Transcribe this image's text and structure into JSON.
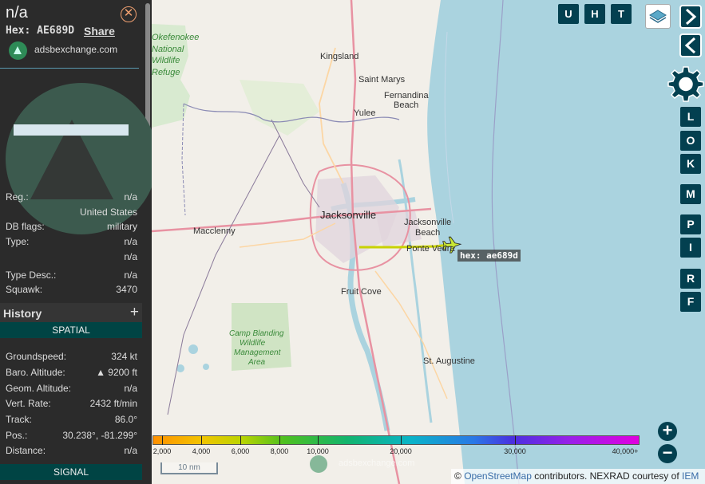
{
  "sidebar": {
    "callsign": "n/a",
    "hex_label": "Hex:",
    "hex_value": "AE689D",
    "share_label": "Share",
    "site_link": "adsbexchange.com",
    "close_icon": "close-icon",
    "details": [
      {
        "label": "Reg.:",
        "value": "n/a"
      },
      {
        "label": "",
        "value": "United States"
      },
      {
        "label": "DB flags:",
        "value": "military"
      },
      {
        "label": "Type:",
        "value": "n/a"
      },
      {
        "label": "",
        "value": "n/a"
      },
      {
        "label": "Type Desc.:",
        "value": "n/a"
      },
      {
        "label": "Squawk:",
        "value": "3470"
      }
    ],
    "history_label": "History",
    "history_toggle": "+",
    "spatial_label": "SPATIAL",
    "spatial": [
      {
        "label": "Groundspeed:",
        "value": "324 kt"
      },
      {
        "label": "Baro. Altitude:",
        "value": "▲ 9200 ft"
      },
      {
        "label": "Geom. Altitude:",
        "value": "n/a"
      },
      {
        "label": "Vert. Rate:",
        "value": "2432 ft/min"
      },
      {
        "label": "Track:",
        "value": "86.0°"
      },
      {
        "label": "Pos.:",
        "value": "30.238°, -81.299°"
      },
      {
        "label": "Distance:",
        "value": "n/a"
      }
    ],
    "signal_label": "SIGNAL"
  },
  "map": {
    "places": [
      "Okefenokee",
      "National",
      "Wildlife",
      "Refuge",
      "Kingsland",
      "Saint Marys",
      "Fernandina",
      "Beach",
      "Yulee",
      "Jacksonville",
      "Jacksonville",
      "Beach",
      "Macclenny",
      "Ponte Vedra",
      "Fruit Cove",
      "Camp Blanding",
      "Wildlife",
      "Management",
      "Area",
      "St. Augustine"
    ],
    "aircraft_label": "hex: ae689d",
    "toolbar": [
      "U",
      "H",
      "T"
    ],
    "side_buttons": [
      "L",
      "O",
      "K",
      "M",
      "P",
      "I",
      "R",
      "F"
    ],
    "nav_next_icon": "chevron-right-icon",
    "nav_prev_icon": "chevron-left-icon",
    "layers_icon": "layers-icon",
    "settings_icon": "gear-icon",
    "zoom_in": "+",
    "zoom_out": "−",
    "altitude_scale": [
      "2,000",
      "4,000",
      "6,000",
      "8,000",
      "10,000",
      "20,000",
      "30,000",
      "40,000+"
    ],
    "scale_label": "10 nm",
    "watermark": "adsbexchange.com",
    "attribution_prefix": "©",
    "attribution_osm": "OpenStreetMap",
    "attribution_mid": "contributors. NEXRAD courtesy of",
    "attribution_iem": "IEM"
  },
  "colors": {
    "panel_bg": "#2b2b2b",
    "button_bg": "#034050",
    "ocean": "#aad3df",
    "land": "#f2efe9",
    "aircraft": "#c8e632"
  }
}
